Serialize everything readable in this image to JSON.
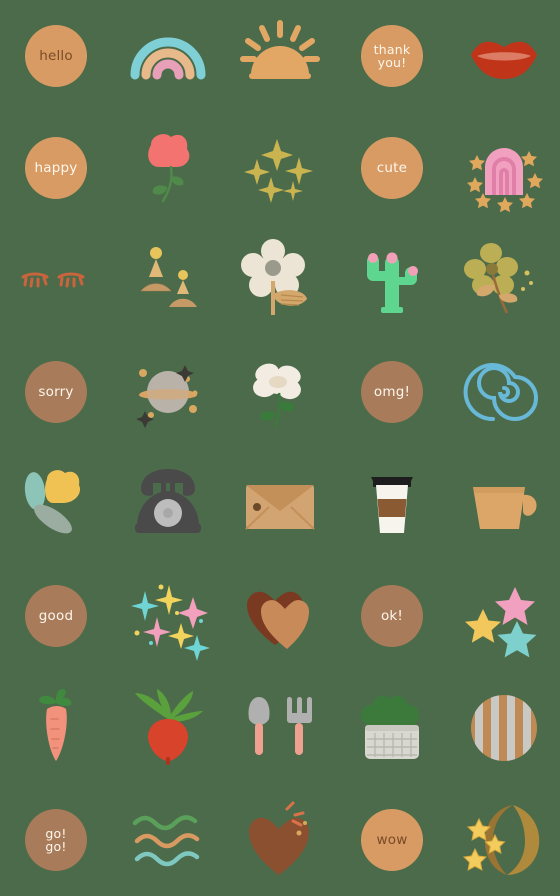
{
  "sheet": {
    "title": "emoji sticker sheet",
    "background_color": "#4c6b4b",
    "columns": 5,
    "rows": 8,
    "cell_size": 112
  },
  "palette": {
    "background": "#4c6b4b",
    "badge_tan": "#d89b63",
    "badge_brown": "#a87c5a",
    "badge_text_dark": "#7a4a28",
    "badge_text_light": "#fdf6ec",
    "rainbow_blue": "#7ed0d6",
    "rainbow_peach": "#e8b98a",
    "rainbow_pink": "#e8a0b8",
    "sun_tan": "#e2a765",
    "lips_red": "#c0341a",
    "lips_highlight": "#e08a72",
    "flower_pink": "#f2736f",
    "stem_green": "#4f8a4a",
    "sparkle_gold": "#c9b450",
    "arch_pink": "#f2a0c0",
    "arch_pink_dark": "#e07fa8",
    "star_gold": "#e0a85c",
    "lash_orange": "#c9643c",
    "earring_gold": "#e8c45c",
    "earring_tan": "#c59a66",
    "daisy_cream": "#ece4d4",
    "daisy_center": "#9a9a8c",
    "leaf_tan": "#d4a86c",
    "cactus_green": "#5fd68f",
    "cactus_flower": "#f2a0b8",
    "flower_olive": "#bcae54",
    "planet_gray": "#b9b2a8",
    "planet_ring": "#e0a765",
    "blossom_white": "#f2ece2",
    "spiral_blue": "#68b8d8",
    "tulip_yellow": "#f0c254",
    "tulip_teal": "#8cc4b8",
    "tulip_sage": "#9aada0",
    "phone_dark": "#4a4a4a",
    "phone_dial": "#bdbdbd",
    "envelope_tan": "#d2a472",
    "envelope_flap": "#c29058",
    "cup_lid": "#1e1e1e",
    "cup_sleeve": "#8a5a32",
    "cup_white": "#f7f4ee",
    "mug_tan": "#dca669",
    "heart_dark": "#7a3a22",
    "heart_light": "#c98a5a",
    "sparkle_cyan": "#6fd4d4",
    "sparkle_yellow": "#f2d45c",
    "sparkle_pink": "#f2a0bc",
    "star_pink": "#f2a0c0",
    "star_yellow": "#f2c85c",
    "star_teal": "#7ed0cc",
    "carrot_orange": "#f2927c",
    "carrot_green": "#3f8a3f",
    "radish_red": "#d8432c",
    "radish_green": "#5aa03c",
    "trowel_gray": "#b0b0b0",
    "trowel_handle": "#f0a090",
    "pot_gray": "#d8d8d0",
    "pot_plant": "#3c7a3c",
    "stripe_tan": "#c08a55",
    "stripe_gray": "#c8c8c4",
    "wave_green": "#5aa05a",
    "wave_orange": "#d89a60",
    "wave_teal": "#7ec8c0",
    "moon_gold": "#b08a3c",
    "moon_star": "#f2cc5c"
  },
  "stickers": [
    {
      "row": 1,
      "col": 1,
      "name": "badge-hello",
      "kind": "badge",
      "label": "hello",
      "fill": "#d89b63",
      "text_color": "#7a4a28"
    },
    {
      "row": 1,
      "col": 2,
      "name": "rainbow",
      "kind": "art",
      "label": "rainbow"
    },
    {
      "row": 1,
      "col": 3,
      "name": "sunrise",
      "kind": "art",
      "label": "sunrise"
    },
    {
      "row": 1,
      "col": 4,
      "name": "badge-thank-you",
      "kind": "badge",
      "label": "thank\nyou!",
      "fill": "#d89b63",
      "text_color": "#fdf6ec"
    },
    {
      "row": 1,
      "col": 5,
      "name": "lips",
      "kind": "art",
      "label": "lips"
    },
    {
      "row": 2,
      "col": 1,
      "name": "badge-happy",
      "kind": "badge",
      "label": "happy",
      "fill": "#d89b63",
      "text_color": "#fdf6ec"
    },
    {
      "row": 2,
      "col": 2,
      "name": "pink-flower",
      "kind": "art",
      "label": "pink flower"
    },
    {
      "row": 2,
      "col": 3,
      "name": "gold-sparkles",
      "kind": "art",
      "label": "gold sparkles"
    },
    {
      "row": 2,
      "col": 4,
      "name": "badge-cute",
      "kind": "badge",
      "label": "cute",
      "fill": "#d89b63",
      "text_color": "#fdf6ec"
    },
    {
      "row": 2,
      "col": 5,
      "name": "pink-arch-stars",
      "kind": "art",
      "label": "pink arch with stars"
    },
    {
      "row": 3,
      "col": 1,
      "name": "eyelashes",
      "kind": "art",
      "label": "eyelashes"
    },
    {
      "row": 3,
      "col": 2,
      "name": "earrings",
      "kind": "art",
      "label": "earrings"
    },
    {
      "row": 3,
      "col": 3,
      "name": "daisy-flower",
      "kind": "art",
      "label": "daisy flower"
    },
    {
      "row": 3,
      "col": 4,
      "name": "cactus",
      "kind": "art",
      "label": "cactus"
    },
    {
      "row": 3,
      "col": 5,
      "name": "olive-flower",
      "kind": "art",
      "label": "olive flower"
    },
    {
      "row": 4,
      "col": 1,
      "name": "badge-sorry",
      "kind": "badge",
      "label": "sorry",
      "fill": "#a87c5a",
      "text_color": "#fdf6ec"
    },
    {
      "row": 4,
      "col": 2,
      "name": "planet",
      "kind": "art",
      "label": "planet"
    },
    {
      "row": 4,
      "col": 3,
      "name": "white-blossom",
      "kind": "art",
      "label": "white blossom"
    },
    {
      "row": 4,
      "col": 4,
      "name": "badge-omg",
      "kind": "badge",
      "label": "omg!",
      "fill": "#a87c5a",
      "text_color": "#fdf6ec"
    },
    {
      "row": 4,
      "col": 5,
      "name": "blue-spiral",
      "kind": "art",
      "label": "blue spiral"
    },
    {
      "row": 5,
      "col": 1,
      "name": "tulip",
      "kind": "art",
      "label": "tulip"
    },
    {
      "row": 5,
      "col": 2,
      "name": "rotary-telephone",
      "kind": "art",
      "label": "rotary telephone"
    },
    {
      "row": 5,
      "col": 3,
      "name": "envelope",
      "kind": "art",
      "label": "envelope"
    },
    {
      "row": 5,
      "col": 4,
      "name": "coffee-cup",
      "kind": "art",
      "label": "coffee cup"
    },
    {
      "row": 5,
      "col": 5,
      "name": "mug",
      "kind": "art",
      "label": "mug"
    },
    {
      "row": 6,
      "col": 1,
      "name": "badge-good",
      "kind": "badge",
      "label": "good",
      "fill": "#a87c5a",
      "text_color": "#fdf6ec"
    },
    {
      "row": 6,
      "col": 2,
      "name": "pastel-sparkles",
      "kind": "art",
      "label": "pastel sparkles"
    },
    {
      "row": 6,
      "col": 3,
      "name": "brown-hearts",
      "kind": "art",
      "label": "brown hearts"
    },
    {
      "row": 6,
      "col": 4,
      "name": "badge-ok",
      "kind": "badge",
      "label": "ok!",
      "fill": "#a87c5a",
      "text_color": "#fdf6ec"
    },
    {
      "row": 6,
      "col": 5,
      "name": "pastel-stars",
      "kind": "art",
      "label": "pastel stars"
    },
    {
      "row": 7,
      "col": 1,
      "name": "carrot",
      "kind": "art",
      "label": "carrot"
    },
    {
      "row": 7,
      "col": 2,
      "name": "radish",
      "kind": "art",
      "label": "radish"
    },
    {
      "row": 7,
      "col": 3,
      "name": "garden-tools",
      "kind": "art",
      "label": "garden tools"
    },
    {
      "row": 7,
      "col": 4,
      "name": "potted-plant",
      "kind": "art",
      "label": "potted plant"
    },
    {
      "row": 7,
      "col": 5,
      "name": "striped-circle",
      "kind": "art",
      "label": "striped circle"
    },
    {
      "row": 8,
      "col": 1,
      "name": "badge-go-go",
      "kind": "badge",
      "label": "go!\ngo!",
      "fill": "#a87c5a",
      "text_color": "#fdf6ec"
    },
    {
      "row": 8,
      "col": 2,
      "name": "wavy-lines",
      "kind": "art",
      "label": "wavy lines"
    },
    {
      "row": 8,
      "col": 3,
      "name": "heart-sparkle",
      "kind": "art",
      "label": "heart with sparkle"
    },
    {
      "row": 8,
      "col": 4,
      "name": "badge-wow",
      "kind": "badge",
      "label": "wow",
      "fill": "#d89b63",
      "text_color": "#7a4a28"
    },
    {
      "row": 8,
      "col": 5,
      "name": "moon-stars",
      "kind": "art",
      "label": "moon with stars"
    }
  ]
}
